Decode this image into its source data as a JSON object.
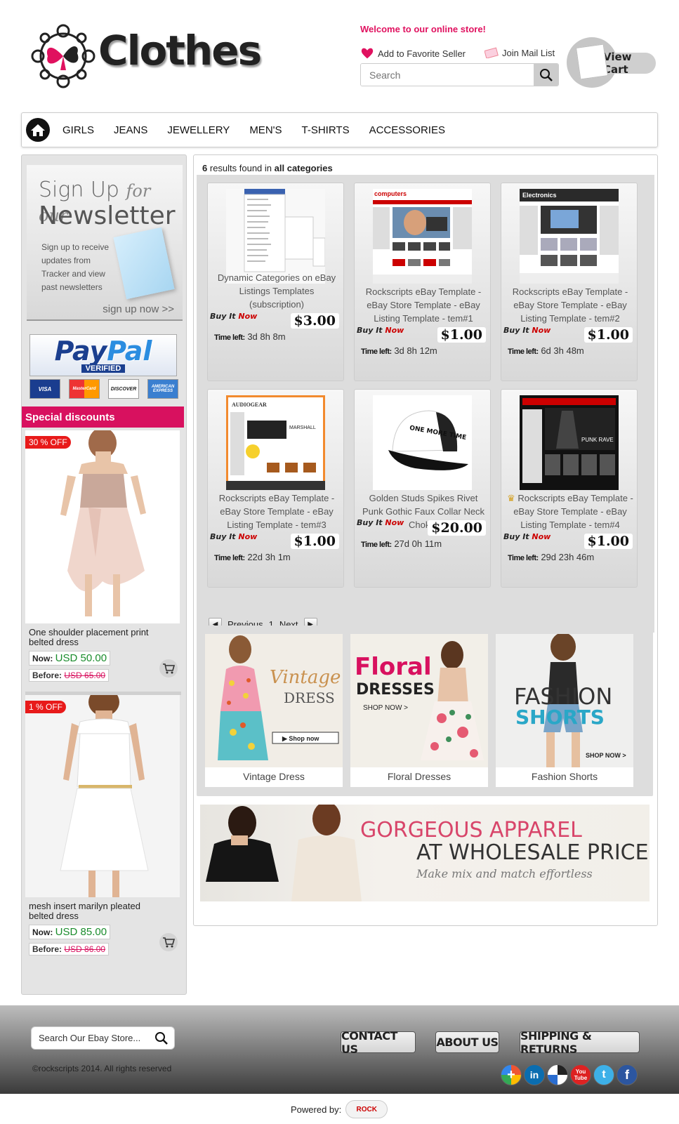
{
  "header": {
    "logo_text": "Clothes",
    "welcome": "Welcome to our online store!",
    "favorite_label": "Add to Favorite Seller",
    "mail_label": "Join Mail List",
    "search_placeholder": "Search",
    "view_cart": "View Cart"
  },
  "nav": {
    "items": [
      "GIRLS",
      "JEANS",
      "JEWELLERY",
      "MEN'S",
      "T-SHIRTS",
      "ACCESSORIES"
    ]
  },
  "sidebar": {
    "newsletter": {
      "line1": "Sign Up",
      "line1b": "for our",
      "line2": "Newsletter",
      "desc": "Sign up to receive updates from Tracker and view past newsletters",
      "link": "sign up now >>"
    },
    "paypal": {
      "logo_a": "Pay",
      "logo_b": "Pal",
      "verified": "VERIFIED"
    },
    "cards": [
      "VISA",
      "MasterCard",
      "DISCOVER",
      "AMERICAN EXPRESS"
    ],
    "discounts_title": "Special discounts",
    "products": [
      {
        "badge": "30 % OFF",
        "name": "One shoulder placement print belted dress",
        "now_label": "Now:",
        "now": "USD 50.00",
        "before_label": "Before:",
        "before": "USD 65.00"
      },
      {
        "badge": "1 % OFF",
        "name": "mesh insert marilyn pleated belted dress",
        "now_label": "Now:",
        "now": "USD 85.00",
        "before_label": "Before:",
        "before": "USD 86.00"
      }
    ]
  },
  "results": {
    "count": "6",
    "mid": "results found in",
    "scope": "all categories"
  },
  "listings": [
    {
      "title": "Dynamic Categories on eBay Listings Templates (subscription)",
      "buy": "Buy It",
      "now": "Now",
      "price": "$3.00",
      "time_label": "Time left:",
      "time": "3d 8h 8m"
    },
    {
      "title": "Rockscripts eBay Template - eBay Store Template - eBay Listing Template - tem#1",
      "buy": "Buy It",
      "now": "Now",
      "price": "$1.00",
      "time_label": "Time left:",
      "time": "3d 8h 12m"
    },
    {
      "title": "Rockscripts eBay Template - eBay Store Template - eBay Listing Template - tem#2",
      "buy": "Buy It",
      "now": "Now",
      "price": "$1.00",
      "time_label": "Time left:",
      "time": "6d 3h 48m"
    },
    {
      "title": "Rockscripts eBay Template - eBay Store Template - eBay Listing Template - tem#3",
      "buy": "Buy It",
      "now": "Now",
      "price": "$1.00",
      "time_label": "Time left:",
      "time": "22d 3h 1m"
    },
    {
      "title": "Golden Studs Spikes Rivet Punk Gothic Faux Collar Neck Choker",
      "buy": "Buy It",
      "now": "Now",
      "price": "$20.00",
      "time_label": "Time left:",
      "time": "27d 0h 11m"
    },
    {
      "title": "Rockscripts eBay Template - eBay Store Template - eBay Listing Template - tem#4",
      "buy": "Buy It",
      "now": "Now",
      "price": "$1.00",
      "time_label": "Time left:",
      "time": "29d 23h 46m"
    }
  ],
  "thumbs": {
    "t2": "computers",
    "t3": "Electronics",
    "t4a": "AUDIOGEAR",
    "t4b": "MARSHALL",
    "cap": "ONE MORE TIME",
    "t6": "PUNK RAVE"
  },
  "pager": {
    "previous": "Previous",
    "page": "1",
    "next": "Next"
  },
  "promos": [
    {
      "caption": "Vintage Dress",
      "art1": "Vintage",
      "art2": "DRESS",
      "cta": "Shop now"
    },
    {
      "caption": "Floral Dresses",
      "art1": "Floral",
      "art2": "DRESSES",
      "cta": "SHOP NOW >"
    },
    {
      "caption": "Fashion Shorts",
      "art1": "FASHION",
      "art2": "SHORTS",
      "cta": "SHOP NOW >"
    }
  ],
  "banner": {
    "line1": "GORGEOUS APPAREL",
    "line2": "AT WHOLESALE PRICES",
    "line3": "Make mix and match effortless"
  },
  "footer": {
    "search_placeholder": "Search Our Ebay Store...",
    "copyright": "©rockscripts 2014. All rights reserved",
    "buttons": [
      "CONTACT US",
      "ABOUT US",
      "SHIPPING & RETURNS"
    ],
    "social": [
      "google-plus",
      "linkedin",
      "delicious",
      "youtube",
      "twitter",
      "facebook"
    ],
    "powered": "Powered by:",
    "rock_logo": "ROCK"
  },
  "colors": {
    "accent": "#e0115f",
    "price_green": "#1a8c2c",
    "buy_red": "#cc0000"
  }
}
